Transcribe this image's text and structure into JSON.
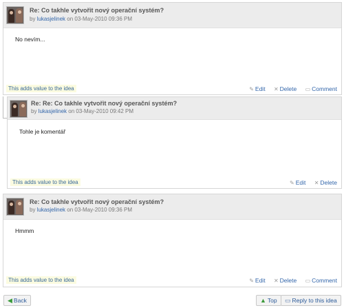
{
  "posts": [
    {
      "title": "Re: Co takhle vytvořit nový operační systém?",
      "by_prefix": "by",
      "author": "lukasjelinek",
      "date": "on 03-May-2010 09:36 PM",
      "body": "No nevím...",
      "value_note": "This adds value to the idea",
      "actions": {
        "edit": "Edit",
        "delete": "Delete",
        "comment": "Comment"
      }
    },
    {
      "title": "Re: Re: Co takhle vytvořit nový operační systém?",
      "by_prefix": "by",
      "author": "lukasjelinek",
      "date": "on 03-May-2010 09:42 PM",
      "body": "Tohle je komentář",
      "value_note": "This adds value to the idea",
      "actions": {
        "edit": "Edit",
        "delete": "Delete"
      }
    },
    {
      "title": "Re: Co takhle vytvořit nový operační systém?",
      "by_prefix": "by",
      "author": "lukasjelinek",
      "date": "on 03-May-2010 09:36 PM",
      "body": "Hmmm",
      "value_note": "This adds value to the idea",
      "actions": {
        "edit": "Edit",
        "delete": "Delete",
        "comment": "Comment"
      }
    }
  ],
  "bottom": {
    "back": "Back",
    "top": "Top",
    "reply": "Reply to this idea"
  },
  "icons": {
    "edit": "pencil-icon",
    "delete": "delete-icon",
    "comment": "comment-icon",
    "back": "arrow-left-icon",
    "top": "arrow-up-icon",
    "reply": "reply-icon"
  }
}
